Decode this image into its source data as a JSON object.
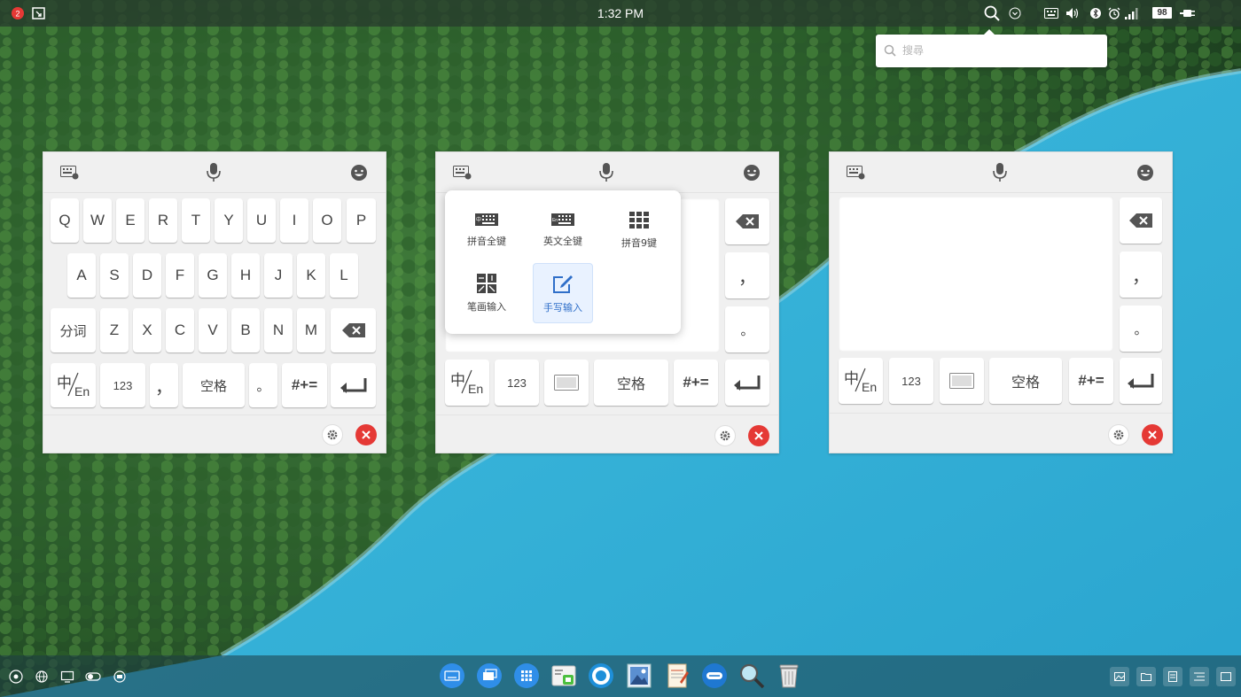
{
  "topbar": {
    "clock": "1:32 PM",
    "battery": "98",
    "icons": [
      "app-logo-icon",
      "screenshot-icon",
      "search-icon",
      "chevron-down-icon",
      "keyboard-icon",
      "volume-icon",
      "bluetooth-icon",
      "alarm-icon",
      "signal-icon",
      "battery-icon",
      "power-plug-icon"
    ]
  },
  "search": {
    "placeholder": "搜尋",
    "value": ""
  },
  "keyboard1": {
    "rows": [
      [
        "Q",
        "W",
        "E",
        "R",
        "T",
        "Y",
        "U",
        "I",
        "O",
        "P"
      ],
      [
        "A",
        "S",
        "D",
        "F",
        "G",
        "H",
        "J",
        "K",
        "L"
      ],
      [
        "分词",
        "Z",
        "X",
        "C",
        "V",
        "B",
        "N",
        "M"
      ]
    ],
    "bottom": {
      "lang_main": "中",
      "lang_sub": "En",
      "num": "123",
      "comma": "，",
      "space": "空格",
      "period": "。",
      "symbols": "#+="
    }
  },
  "keyboard2": {
    "side": {
      "comma": "，",
      "period": "。"
    },
    "bottom": {
      "lang_main": "中",
      "lang_sub": "En",
      "num": "123",
      "space": "空格",
      "symbols": "#+="
    }
  },
  "keyboard3": {
    "side": {
      "comma": "，",
      "period": "。"
    },
    "bottom": {
      "lang_main": "中",
      "lang_sub": "En",
      "num": "123",
      "space": "空格",
      "symbols": "#+="
    }
  },
  "mode_popup": {
    "items": [
      {
        "label": "拼音全键",
        "icon": "pinyin-full-keyboard-icon"
      },
      {
        "label": "英文全键",
        "icon": "english-full-keyboard-icon"
      },
      {
        "label": "拼音9键",
        "icon": "pinyin-9-key-icon"
      },
      {
        "label": "笔画输入",
        "icon": "stroke-input-icon"
      },
      {
        "label": "手写输入",
        "icon": "handwriting-input-icon",
        "selected": true
      }
    ]
  },
  "dock": {
    "apps": [
      "onboard-keyboard",
      "window-manager",
      "launcher",
      "image-viewer",
      "browser",
      "photos",
      "text-editor",
      "chat",
      "search",
      "trash"
    ],
    "left_icons": [
      "settings-icon",
      "network-icon",
      "display-icon",
      "toggle-icon",
      "rotate-icon"
    ],
    "right_icons": [
      "image-icon",
      "folder-icon",
      "document-icon",
      "list-icon",
      "show-desktop-icon"
    ]
  },
  "colors": {
    "accent": "#2f6fc9",
    "close": "#e53935",
    "panel": "#f0f0f0"
  }
}
